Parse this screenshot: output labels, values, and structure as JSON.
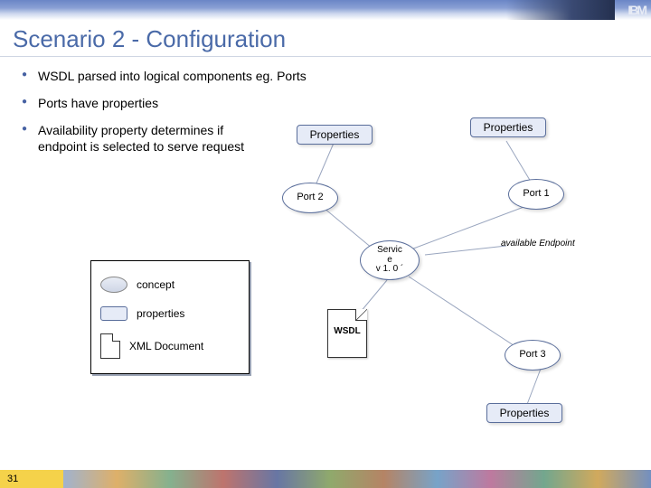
{
  "header": {
    "logo": "IBM"
  },
  "title": "Scenario 2 - Configuration",
  "bullets": [
    "WSDL parsed into logical components eg. Ports",
    "Ports have properties",
    "Availability property determines if endpoint is selected to serve request"
  ],
  "nodes": {
    "properties_mid": "Properties",
    "properties_top": "Properties",
    "properties_bot": "Properties",
    "port1": "Port 1",
    "port2": "Port 2",
    "port3": "Port 3",
    "service": "Servic\ne\nv 1. 0 ´",
    "wsdl": "WSDL"
  },
  "annotation": "available Endpoint",
  "legend": {
    "concept": "concept",
    "properties": "properties",
    "xml": "XML Document"
  },
  "slide_number": "31"
}
